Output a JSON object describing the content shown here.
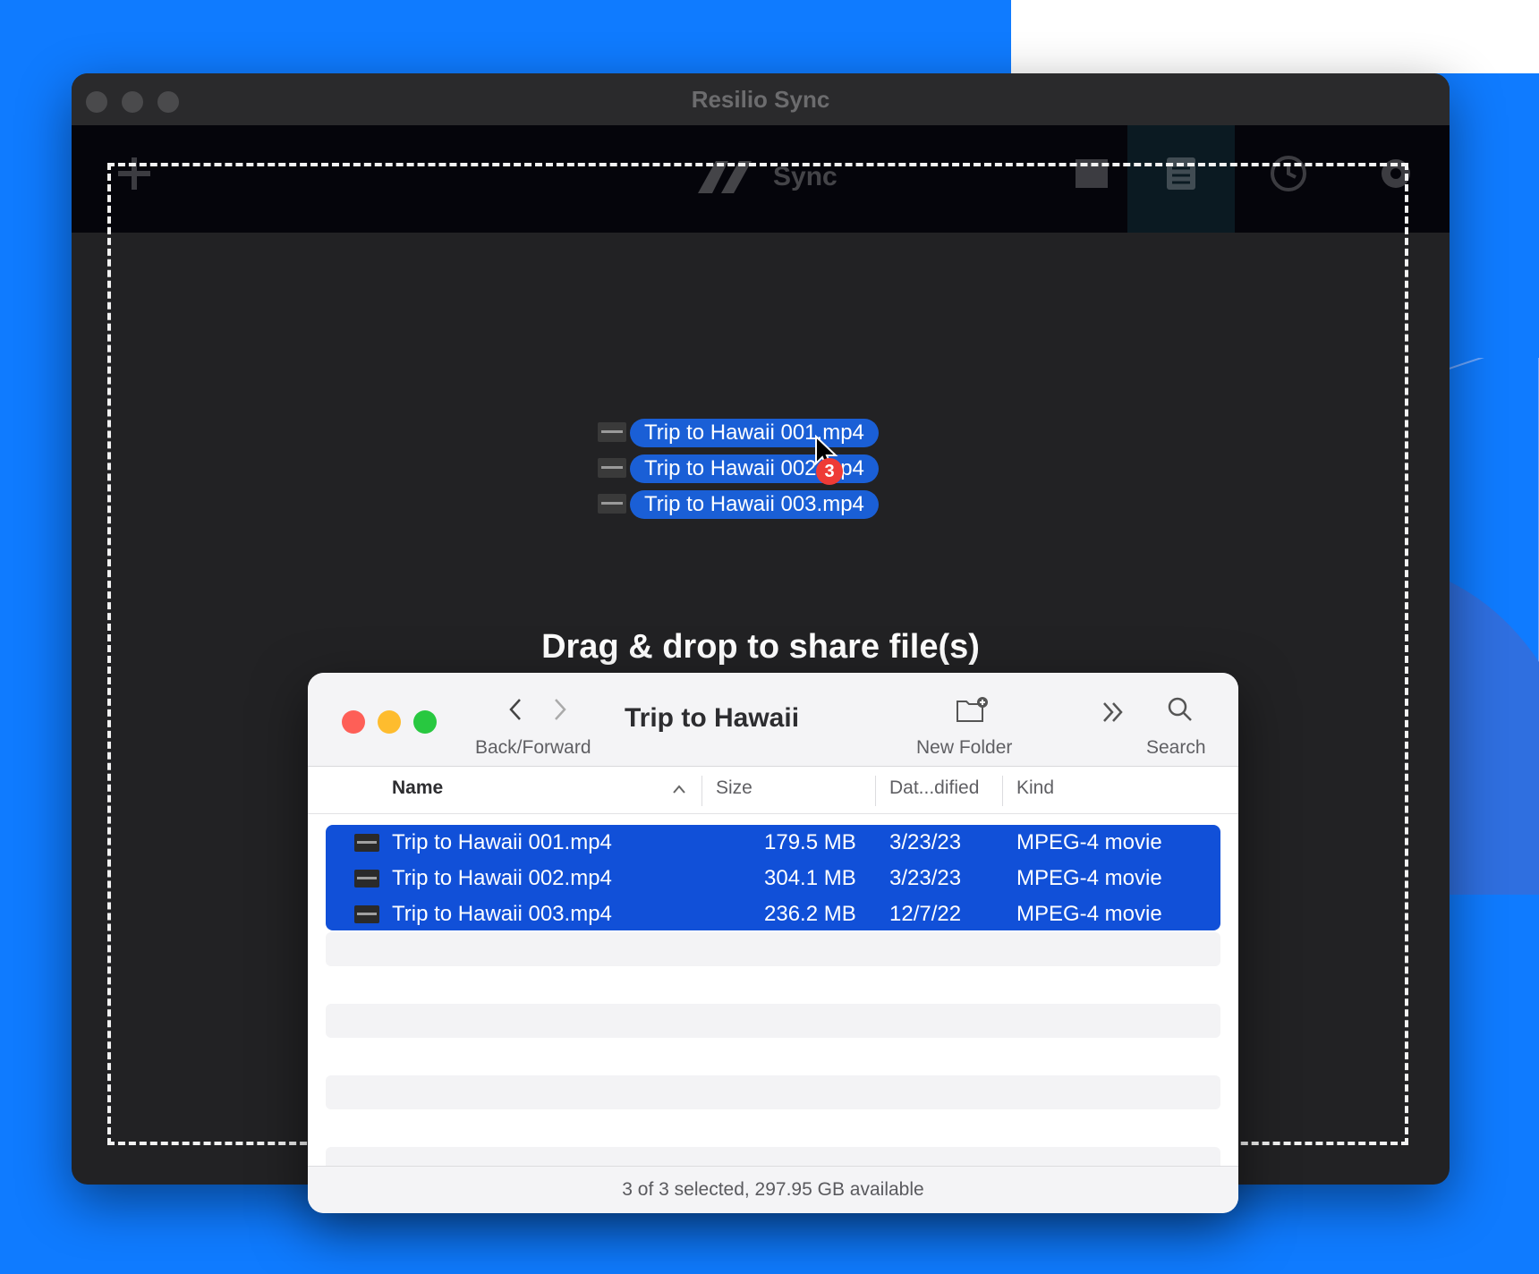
{
  "app": {
    "title": "Resilio Sync",
    "logo_text": "Sync",
    "drop_prompt": "Drag & drop to share file(s)"
  },
  "toolbar_icons": [
    "add-icon",
    "sync-logo-icon",
    "folder-icon",
    "files-icon",
    "history-icon",
    "gear-icon"
  ],
  "drag": {
    "items": [
      {
        "label": "Trip to Hawaii 001.mp4"
      },
      {
        "label": "Trip to Hawaii 002.mp4"
      },
      {
        "label": "Trip to Hawaii 003.mp4"
      }
    ],
    "badge_count": "3"
  },
  "finder": {
    "title": "Trip to Hawaii",
    "back_forward_label": "Back/Forward",
    "new_folder_label": "New Folder",
    "search_label": "Search",
    "columns": {
      "name": "Name",
      "size": "Size",
      "date": "Dat...dified",
      "kind": "Kind"
    },
    "rows": [
      {
        "name": "Trip to Hawaii 001.mp4",
        "size": "179.5 MB",
        "date": "3/23/23",
        "kind": "MPEG-4 movie"
      },
      {
        "name": "Trip to Hawaii 002.mp4",
        "size": "304.1 MB",
        "date": "3/23/23",
        "kind": "MPEG-4 movie"
      },
      {
        "name": "Trip to Hawaii 003.mp4",
        "size": "236.2 MB",
        "date": "12/7/22",
        "kind": "MPEG-4 movie"
      }
    ],
    "status": "3 of 3 selected, 297.95 GB available"
  },
  "colors": {
    "desktop": "#0f7bff",
    "selection": "#1150d8",
    "badge": "#ee3b36",
    "close": "#fe5f57",
    "minimize": "#febc2e",
    "zoom": "#28c840"
  }
}
